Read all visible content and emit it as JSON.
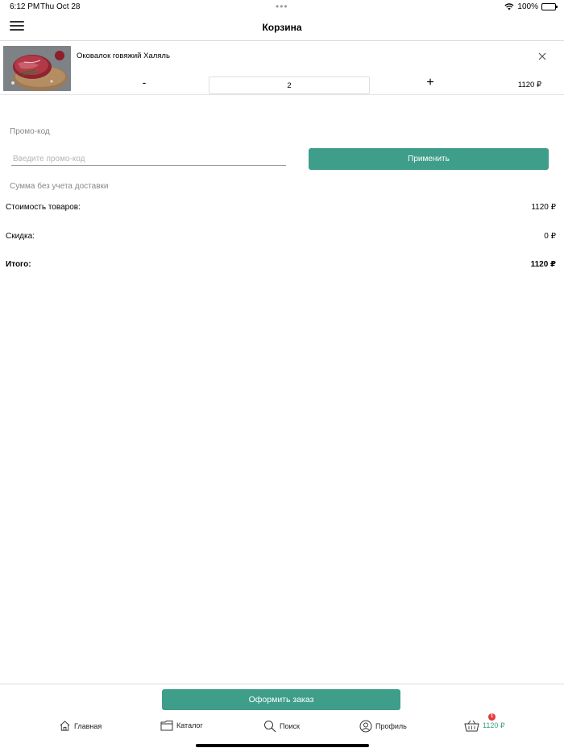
{
  "status_bar": {
    "time": "6:12 PM",
    "date": "Thu Oct 28",
    "dots": "•••",
    "battery": "100%"
  },
  "nav": {
    "title": "Корзина",
    "menu_icon": "hamburger-icon"
  },
  "cart_item": {
    "name": "Оковалок говяжий Халяль",
    "quantity": "2",
    "price": "1120 ₽",
    "minus_label": "-",
    "plus_label": "+",
    "remove_icon": "close-icon"
  },
  "promo": {
    "label": "Промо-код",
    "placeholder": "Введите промо-код",
    "apply_label": "Применить"
  },
  "summary": {
    "note": "Сумма без учета доставки",
    "goods_label": "Стоимость товаров:",
    "goods_value": "1120 ₽",
    "discount_label": "Скидка:",
    "discount_value": "0 ₽",
    "total_label": "Итого:",
    "total_value": "1120 ₽"
  },
  "checkout_label": "Оформить заказ",
  "tabs": [
    {
      "label": "Главная",
      "icon": "home-icon"
    },
    {
      "label": "Каталог",
      "icon": "folder-icon"
    },
    {
      "label": "Поиск",
      "icon": "search-icon"
    },
    {
      "label": "Профиль",
      "icon": "profile-icon"
    },
    {
      "label": "1120 ₽",
      "icon": "basket-icon",
      "badge": "1"
    }
  ],
  "colors": {
    "accent": "#3f9e8a",
    "badge": "#e53935"
  }
}
